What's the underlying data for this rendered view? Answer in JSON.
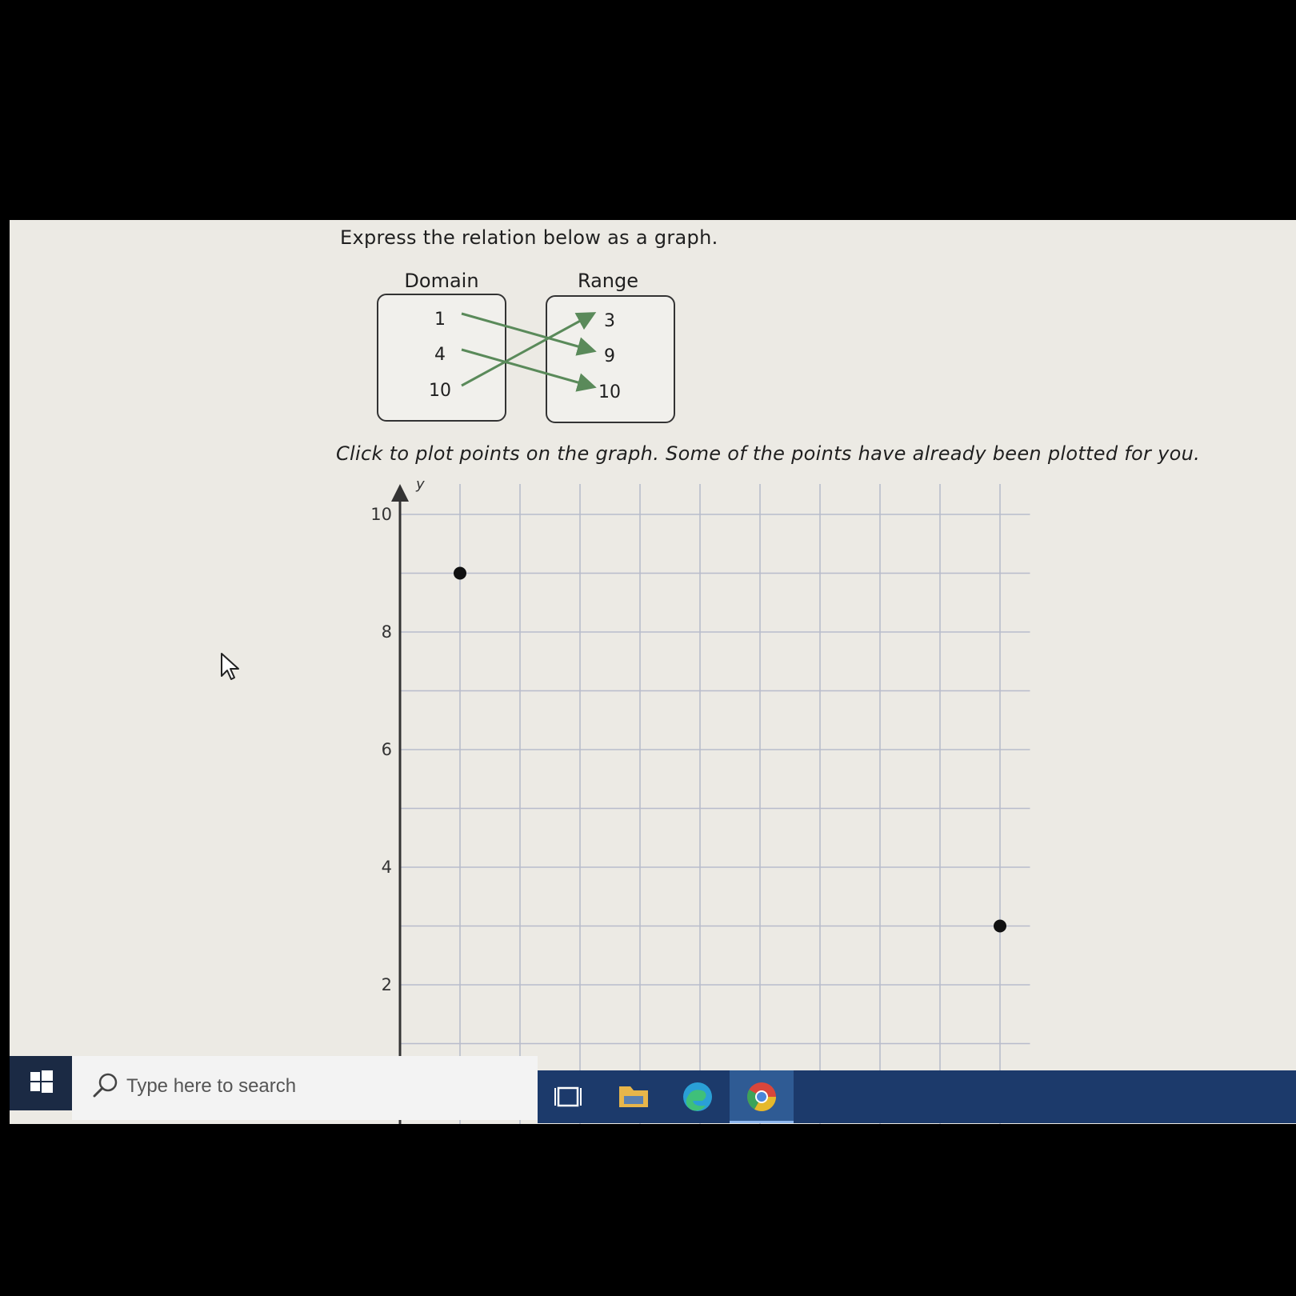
{
  "problem": {
    "instruction": "Express the relation below as a graph.",
    "click_instruction": "Click to plot points on the graph. Some of the points have already been plotted for you."
  },
  "mapping": {
    "domain_title": "Domain",
    "range_title": "Range",
    "domain": [
      "1",
      "4",
      "10"
    ],
    "range": [
      "3",
      "9",
      "10"
    ],
    "arrows": [
      {
        "from": "1",
        "to": "9"
      },
      {
        "from": "4",
        "to": "10"
      },
      {
        "from": "10",
        "to": "3"
      }
    ],
    "arrow_color": "#5a8a5a"
  },
  "chart_data": {
    "type": "scatter",
    "ylabel": "y",
    "y_ticks": [
      "10",
      "8",
      "6",
      "4",
      "2"
    ],
    "ylim": [
      1,
      10
    ],
    "xlim": [
      0,
      10.5
    ],
    "grid": true,
    "points": [
      {
        "x": 1,
        "y": 9
      },
      {
        "x": 10,
        "y": 3
      }
    ]
  },
  "taskbar": {
    "search_placeholder": "Type here to search",
    "accent": "#1c3a6b"
  }
}
